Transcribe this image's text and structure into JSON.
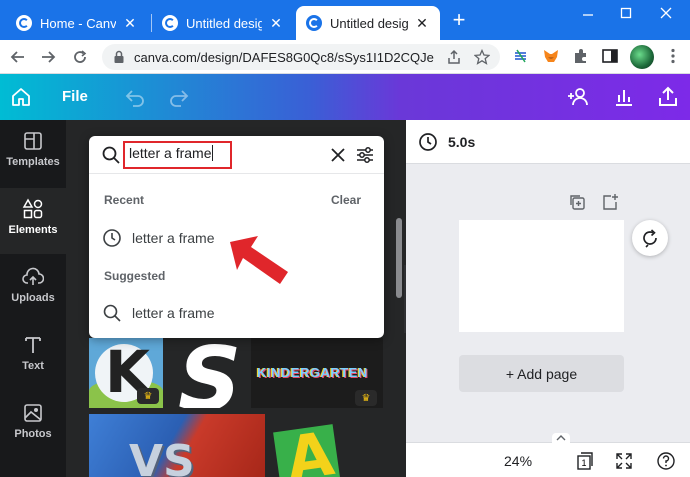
{
  "browser": {
    "tabs": [
      {
        "title": "Home - Canva"
      },
      {
        "title": "Untitled design - Ca"
      },
      {
        "title": "Untitled design - Ca",
        "active": true
      }
    ],
    "new_tab": "+",
    "url": "canva.com/design/DAFES8G0Qc8/sSys1I1D2CQJe...",
    "tab_close": "✕"
  },
  "canva": {
    "file_label": "File"
  },
  "sidenav": {
    "items": [
      {
        "label": "Templates"
      },
      {
        "label": "Elements",
        "active": true
      },
      {
        "label": "Uploads"
      },
      {
        "label": "Text"
      },
      {
        "label": "Photos"
      }
    ]
  },
  "search": {
    "query": "letter a frame",
    "recent_label": "Recent",
    "clear_label": "Clear",
    "recent_items": [
      "letter a frame"
    ],
    "suggested_label": "Suggested",
    "suggested_items": [
      "letter a frame"
    ]
  },
  "thumbnails": {
    "kindergarten_text": "KINDERGARTEN",
    "vs_text": "VS",
    "k_text": "K",
    "s_text": "S",
    "a_text": "A",
    "crown": "♛"
  },
  "canvas": {
    "duration": "5.0s",
    "add_page": "+ Add page",
    "zoom": "24%",
    "page_count": "1"
  },
  "colors": {
    "accent_red": "#e0262b",
    "canva_purple": "#7d2ae8",
    "canva_teal": "#00bcd4",
    "chrome_blue": "#1a73e8"
  }
}
